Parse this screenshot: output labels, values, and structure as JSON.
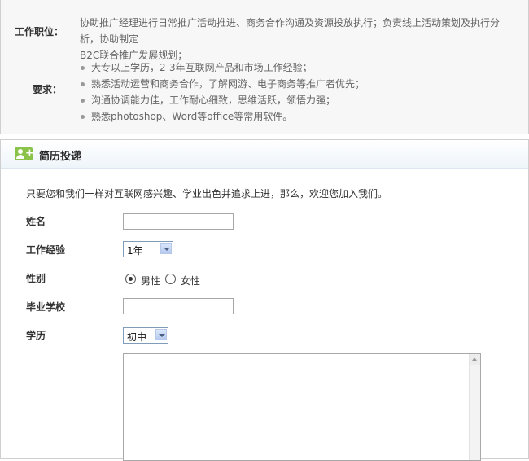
{
  "job": {
    "duty_label": "工作职位：",
    "duty_text_line1": "协助推广经理进行日常推广活动推进、商务合作沟通及资源投放执行；负责线上活动策划及执行分析，协助制定",
    "duty_text_line2": "B2C联合推广发展规划；",
    "req_label": "要求：",
    "requirements": [
      "大专以上学历，2-3年互联网产品和市场工作经验；",
      "熟悉活动运营和商务合作，了解网游、电子商务等推广者优先；",
      "沟通协调能力佳，工作耐心细致，思维活跃，领悟力强；",
      "熟悉photoshop、Word等office等常用软件。"
    ]
  },
  "resume": {
    "title": "简历投递",
    "intro": "只要您和我们一样对互联网感兴趣、学业出色并追求上进，那么，欢迎您加入我们。",
    "name_label": "姓名",
    "experience_label": "工作经验",
    "experience_value": "1年",
    "gender_label": "性别",
    "gender_male": "男性",
    "gender_female": "女性",
    "school_label": "毕业学校",
    "education_label": "学历",
    "education_value": "初中"
  }
}
